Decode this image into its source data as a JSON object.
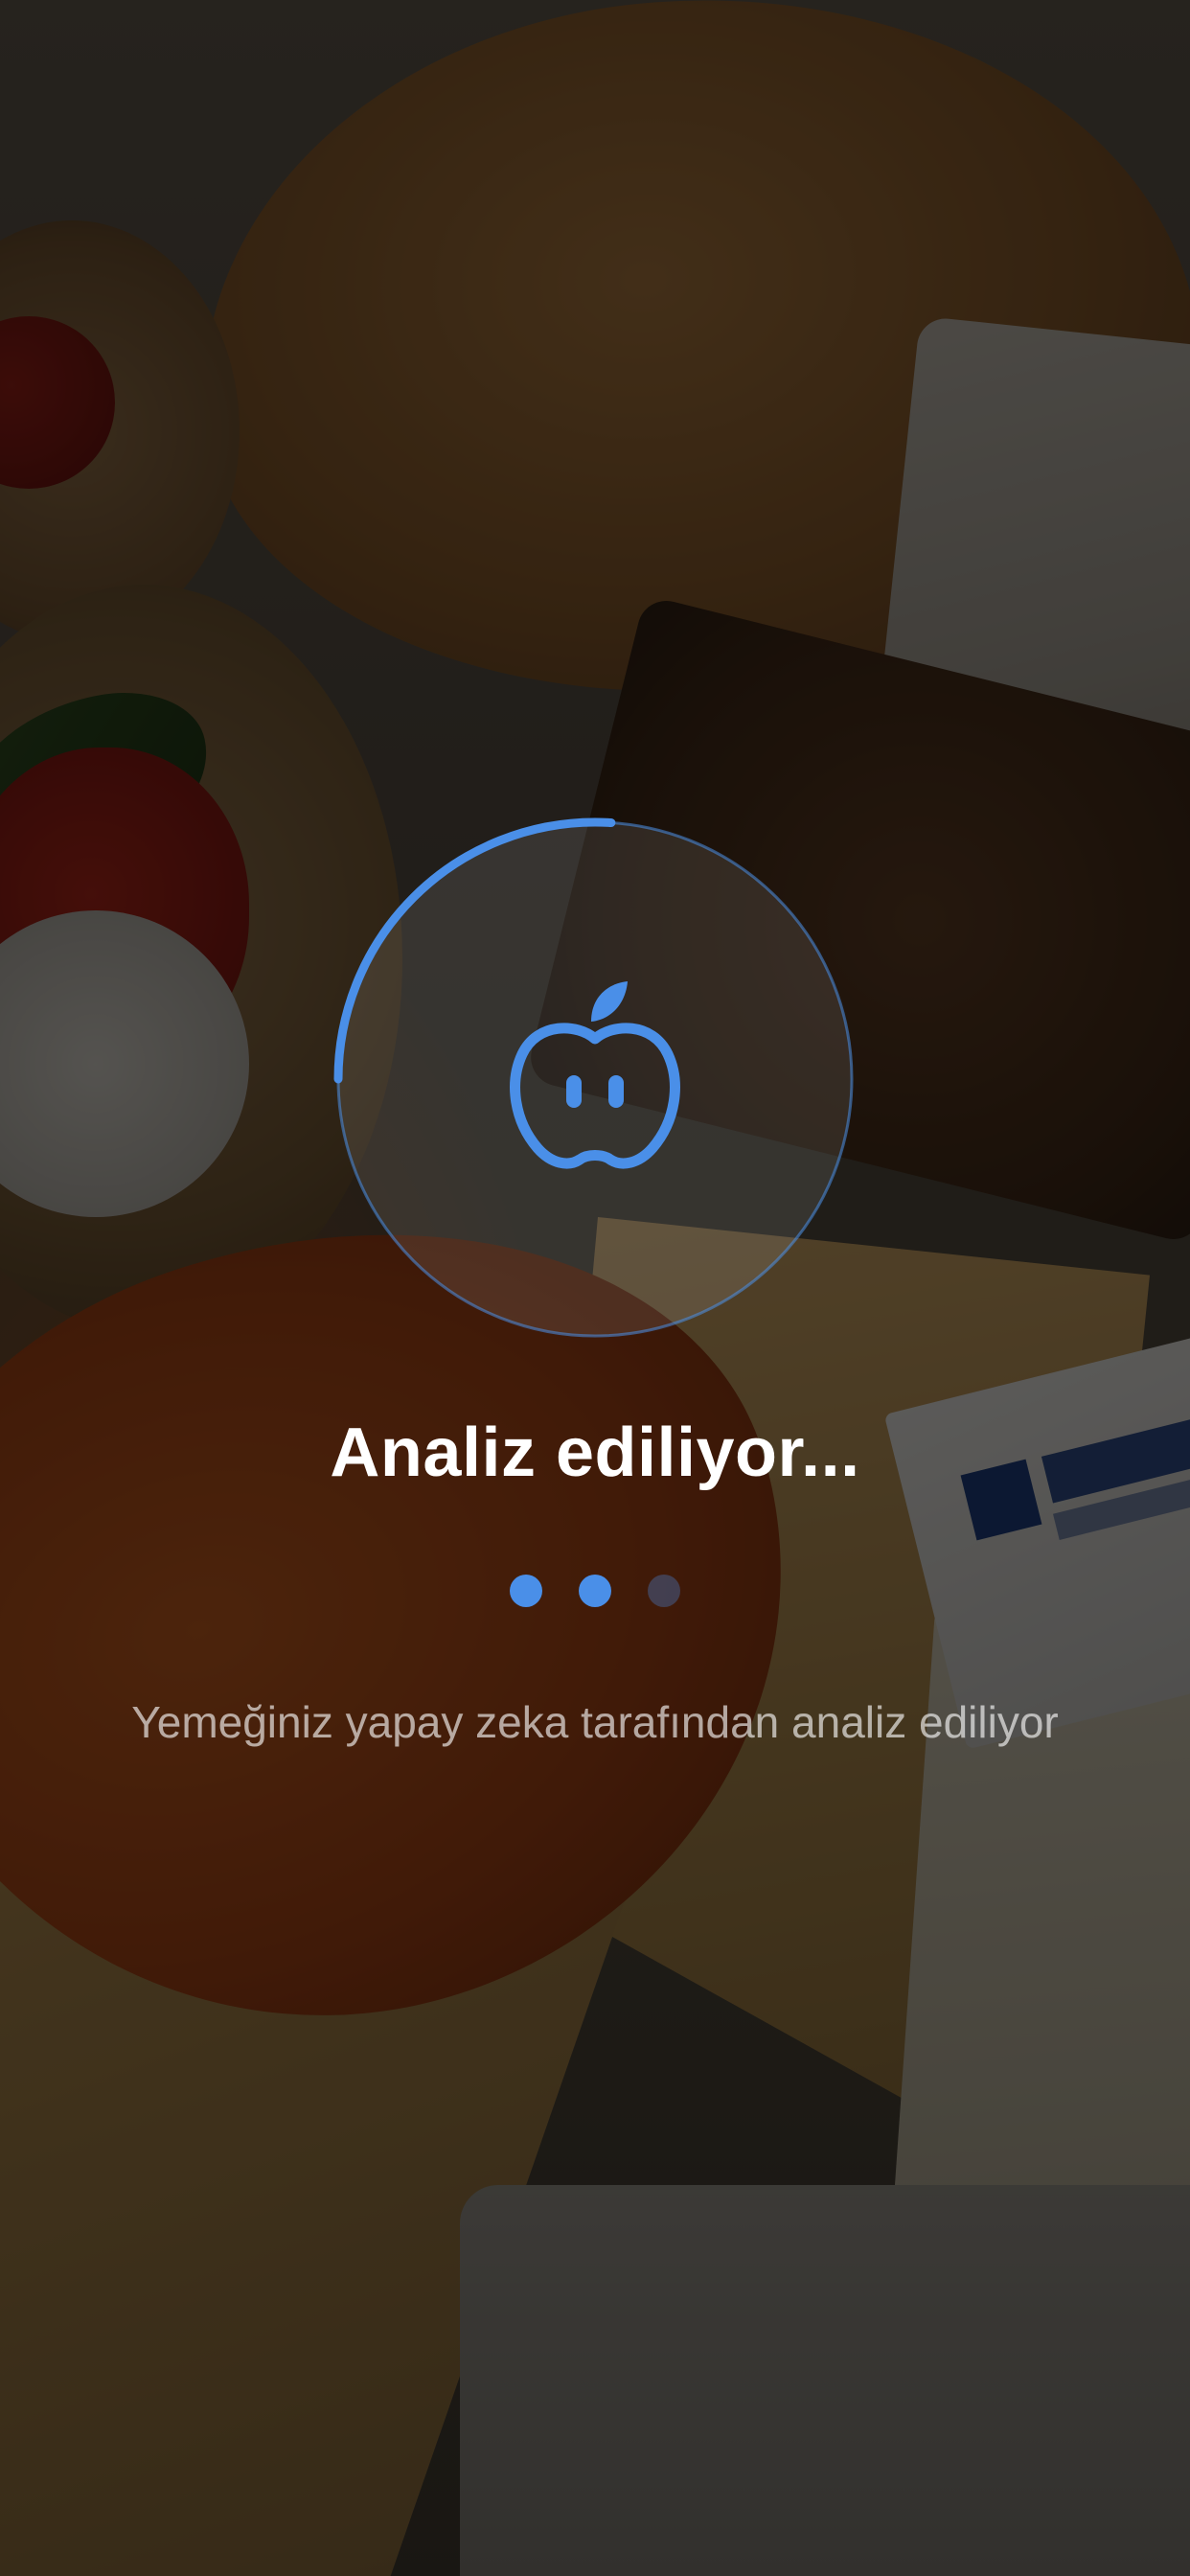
{
  "status": {
    "title": "Analiz ediliyor...",
    "subtitle": "Yemeğiniz yapay zeka tarafından analiz ediliyor",
    "progress_fraction": 0.26,
    "dots_active": 2,
    "dots_total": 3
  },
  "icons": {
    "center_icon": "apple-face-icon"
  },
  "colors": {
    "accent": "#4a8fe8",
    "accent_inactive": "rgba(74,143,232,0.32)",
    "title": "#ffffff",
    "subtitle": "rgba(255,255,255,0.62)",
    "overlay": "rgba(0,0,0,0.58)"
  }
}
